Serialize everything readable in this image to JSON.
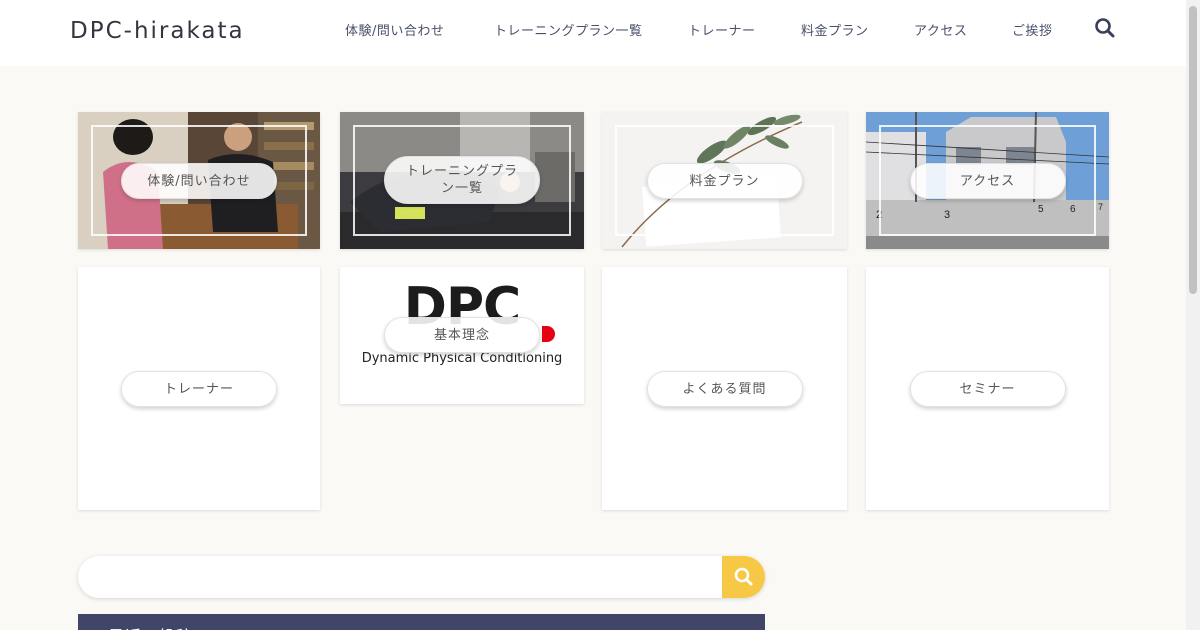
{
  "header": {
    "logo": "DPC-hirakata",
    "nav": [
      "体験/問い合わせ",
      "トレーニングプラン一覧",
      "トレーナー",
      "料金プラン",
      "アクセス",
      "ご挨拶"
    ],
    "search_icon": "search-icon"
  },
  "cards": {
    "trial": "体験/問い合わせ",
    "plans_line1": "トレーニングプラ",
    "plans_line2": "ン一覧",
    "pricing": "料金プラン",
    "access": "アクセス",
    "trainer": "トレーナー",
    "philosophy": "基本理念",
    "faq": "よくある質問",
    "seminar": "セミナー",
    "dpc_logo_big": "DPC",
    "dpc_logo_sub": "Dynamic Physical Conditioning",
    "house_numbers": [
      "2",
      "3",
      "5",
      "6",
      "7"
    ]
  },
  "search": {
    "placeholder": "",
    "button_icon": "search-icon"
  },
  "sidebar": {
    "recent_posts_label": "最近の投稿"
  },
  "colors": {
    "background": "#fbf9f5",
    "accent_yellow": "#f7c845",
    "nav_text": "#4a4f6a",
    "recent_bar": "#414568"
  }
}
